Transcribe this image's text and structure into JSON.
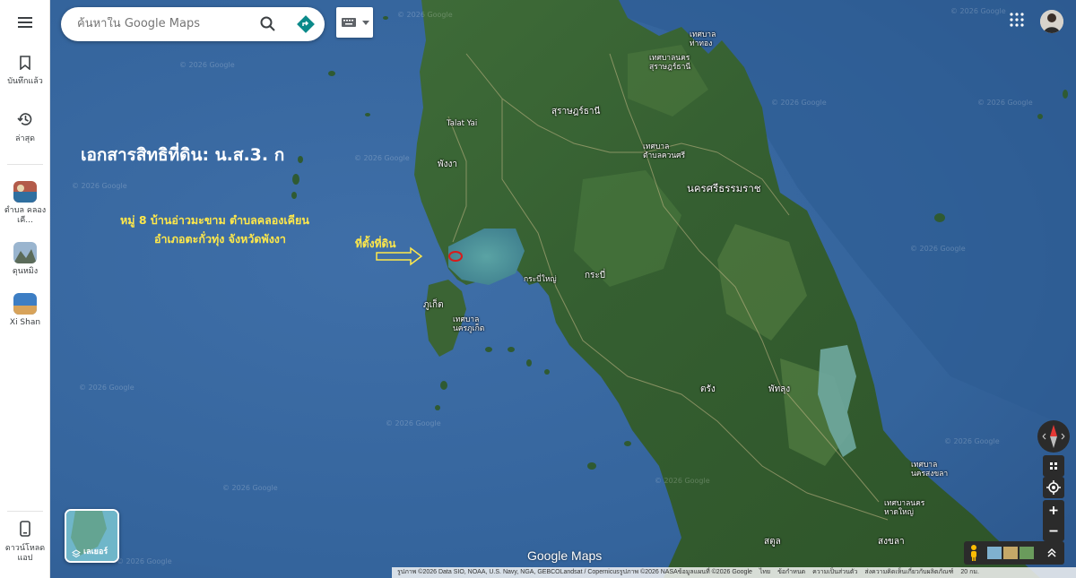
{
  "search": {
    "placeholder": "ค้นหาใน Google Maps"
  },
  "sidebar": {
    "saved_label": "บันทึกแล้ว",
    "recent_label": "ล่าสุด",
    "recents": [
      {
        "label": "ตำบล คลองเคี..."
      },
      {
        "label": "ดุนหมิง"
      },
      {
        "label": "Xi Shan"
      }
    ],
    "download_label": "ดาวน์โหลดแอป"
  },
  "annotations": {
    "title": "เอกสารสิทธิที่ดิน: น.ส.3. ก",
    "address_line1": "หมู่ 8 บ้านอ่าวมะขาม ตำบลคลองเคียน",
    "address_line2": "อำเภอตะกั่วทุ่ง จังหวัดพังงา",
    "site_label": "ที่ตั้งที่ดิน",
    "arrow_color": "#ffe84a",
    "marker_color": "#d81b1b"
  },
  "map_labels": {
    "tessaban_thathong": "เทศบาล\nท่าทอง",
    "tessaban_surat": "เทศบาลนคร\nสุราษฎร์ธานี",
    "surat": "สุราษฎร์ธานี",
    "talat_yai": "Talat Yai",
    "tessaban_khuan": "เทศบาล\nตำบลควนศรี",
    "phangnga": "พังงา",
    "nakhon": "นครศรีธรรมราช",
    "krabi_yai": "กระบี่ใหญ่",
    "krabi": "กระบี่",
    "phuket": "ภูเก็ต",
    "tessaban_phuket": "เทศบาล\nนครภูเก็ต",
    "trang": "ตรัง",
    "phatthalung": "พัทลุง",
    "tessaban_songkhla": "เทศบาล\nนครสงขลา",
    "tessaban_hatyai": "เทศบาลนคร\nหาดใหญ่",
    "satun": "สตูล",
    "songkhla": "สงขลา"
  },
  "watermark": "© 2026 Google",
  "layers": {
    "label": "เลเยอร์"
  },
  "brand": "Google Maps",
  "attribution": {
    "imagery": "รูปภาพ ©2026 Data SIO, NOAA, U.S. Navy, NGA, GEBCOLandsat / Copernicusรูปภาพ ©2026 NASAข้อมูลแผนที่ ©2026 Google",
    "lang": "ไทย",
    "terms": "ข้อกำหนด",
    "privacy": "ความเป็นส่วนตัว",
    "feedback": "ส่งความคิดเห็นเกี่ยวกับผลิตภัณฑ์",
    "scale": "20 กม."
  }
}
